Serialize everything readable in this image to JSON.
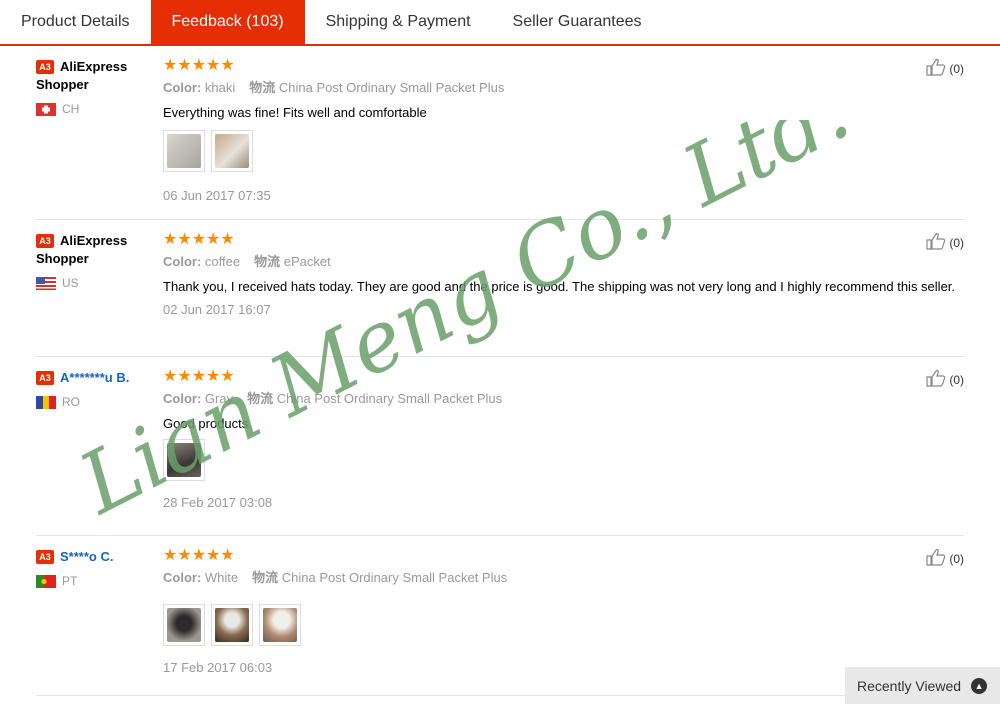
{
  "tabs": [
    {
      "label": "Product Details"
    },
    {
      "label": "Feedback (103)"
    },
    {
      "label": "Shipping & Payment"
    },
    {
      "label": "Seller Guarantees"
    }
  ],
  "reviews": [
    {
      "level": "A3",
      "buyer": "AliExpress Shopper",
      "country": "CH",
      "stars": "★★★★★",
      "color_label": "Color:",
      "color": "khaki",
      "logistics_label": "物流",
      "logistics": "China Post Ordinary Small Packet Plus",
      "text": "Everything was fine! Fits well and comfortable",
      "date": "06 Jun 2017 07:35",
      "useful": "(0)"
    },
    {
      "level": "A3",
      "buyer": "AliExpress Shopper",
      "country": "US",
      "stars": "★★★★★",
      "color_label": "Color:",
      "color": "coffee",
      "logistics_label": "物流",
      "logistics": "ePacket",
      "text": "Thank you, I received hats today. They are good and the price is good. The shipping was not very long and I highly recommend this seller.",
      "date": "02 Jun 2017 16:07",
      "useful": "(0)"
    },
    {
      "level": "A3",
      "buyer": "A*******u B.",
      "country": "RO",
      "stars": "★★★★★",
      "color_label": "Color:",
      "color": "Gray",
      "logistics_label": "物流",
      "logistics": "China Post Ordinary Small Packet Plus",
      "text": "Good products",
      "date": "28 Feb 2017 03:08",
      "useful": "(0)"
    },
    {
      "level": "A3",
      "buyer": "S****o C.",
      "country": "PT",
      "stars": "★★★★★",
      "color_label": "Color:",
      "color": "White",
      "logistics_label": "物流",
      "logistics": "China Post Ordinary Small Packet Plus",
      "text": "",
      "date": "17 Feb 2017 06:03",
      "useful": "(0)"
    }
  ],
  "watermark": "Lian Meng Co., Ltd.",
  "recently_viewed": "Recently Viewed",
  "colors": {
    "accent": "#e62e04",
    "star": "#ff8a00",
    "watermark": "#6a9f6a",
    "buyer_link": "#1565c0"
  }
}
